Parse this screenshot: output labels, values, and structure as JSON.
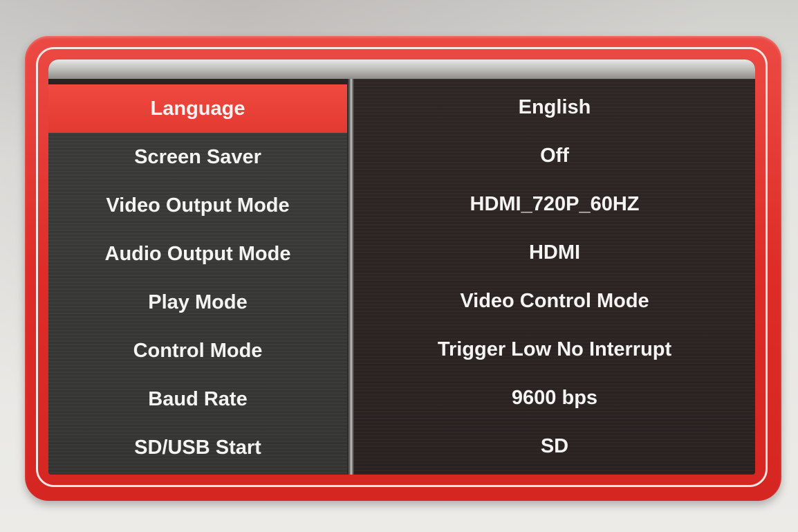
{
  "settings_menu": {
    "rows": [
      {
        "label": "Language",
        "value": "English"
      },
      {
        "label": "Screen Saver",
        "value": "Off"
      },
      {
        "label": "Video Output Mode",
        "value": "HDMI_720P_60HZ"
      },
      {
        "label": "Audio Output Mode",
        "value": "HDMI"
      },
      {
        "label": "Play Mode",
        "value": "Video Control Mode"
      },
      {
        "label": "Control Mode",
        "value": "Trigger Low No Interrupt"
      },
      {
        "label": "Baud Rate",
        "value": "9600 bps"
      },
      {
        "label": "SD/USB Start",
        "value": "SD"
      }
    ],
    "selected_index": 0
  },
  "colors": {
    "frame_red": "#de2d28",
    "selection_red": "#e23a31",
    "panel_dark": "#2b2423",
    "text": "#f4f4f2"
  }
}
